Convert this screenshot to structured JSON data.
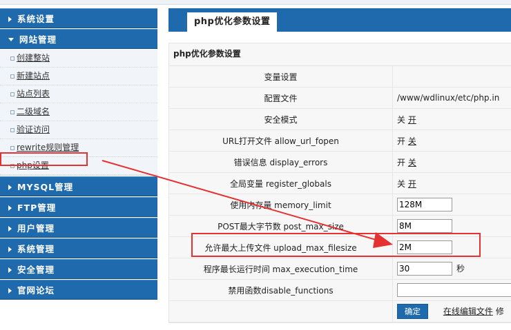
{
  "sidebar": {
    "sections": [
      {
        "label": "系统设置"
      },
      {
        "label": "网站管理"
      },
      {
        "label": "MYSQL管理"
      },
      {
        "label": "FTP管理"
      },
      {
        "label": "用户管理"
      },
      {
        "label": "系统管理"
      },
      {
        "label": "安全管理"
      },
      {
        "label": "官网论坛"
      }
    ],
    "site_items": [
      {
        "label": "创建整站"
      },
      {
        "label": "新建站点"
      },
      {
        "label": "站点列表"
      },
      {
        "label": "二级域名"
      },
      {
        "label": "验证访问"
      },
      {
        "label": "rewrite规则管理"
      },
      {
        "label": "php设置"
      }
    ]
  },
  "main": {
    "tab": "php优化参数设置",
    "panel_title": "php优化参数设置",
    "rows": {
      "header": {
        "label": "变量设置"
      },
      "config_file": {
        "label": "配置文件",
        "value": "/www/wdlinux/etc/php.in"
      },
      "safe_mode": {
        "label": "安全模式",
        "off": "关",
        "on": "开"
      },
      "url_fopen": {
        "label": "URL打开文件 allow_url_fopen",
        "on": "开",
        "off": "关"
      },
      "display_errors": {
        "label": "错误信息 display_errors",
        "on": "开",
        "off": "关"
      },
      "register_globals": {
        "label": "全局变量 register_globals",
        "off": "关",
        "on": "开"
      },
      "memory_limit": {
        "label": "使用内存量 memory_limit",
        "value": "128M"
      },
      "post_max_size": {
        "label": "POST最大字节数 post_max_size",
        "value": "8M"
      },
      "upload_max_filesize": {
        "label": "允许最大上传文件 upload_max_filesize",
        "value": "2M"
      },
      "max_execution_time": {
        "label": "程序最长运行时间 max_execution_time",
        "value": "30",
        "unit": "秒"
      },
      "disable_functions": {
        "label": "禁用函数disable_functions",
        "value": ""
      }
    },
    "submit_label": "确定",
    "edit_link": "在线编辑文件",
    "edit_trail": "修"
  },
  "annotation_color": "#e53131",
  "accent": "#1e6aad"
}
